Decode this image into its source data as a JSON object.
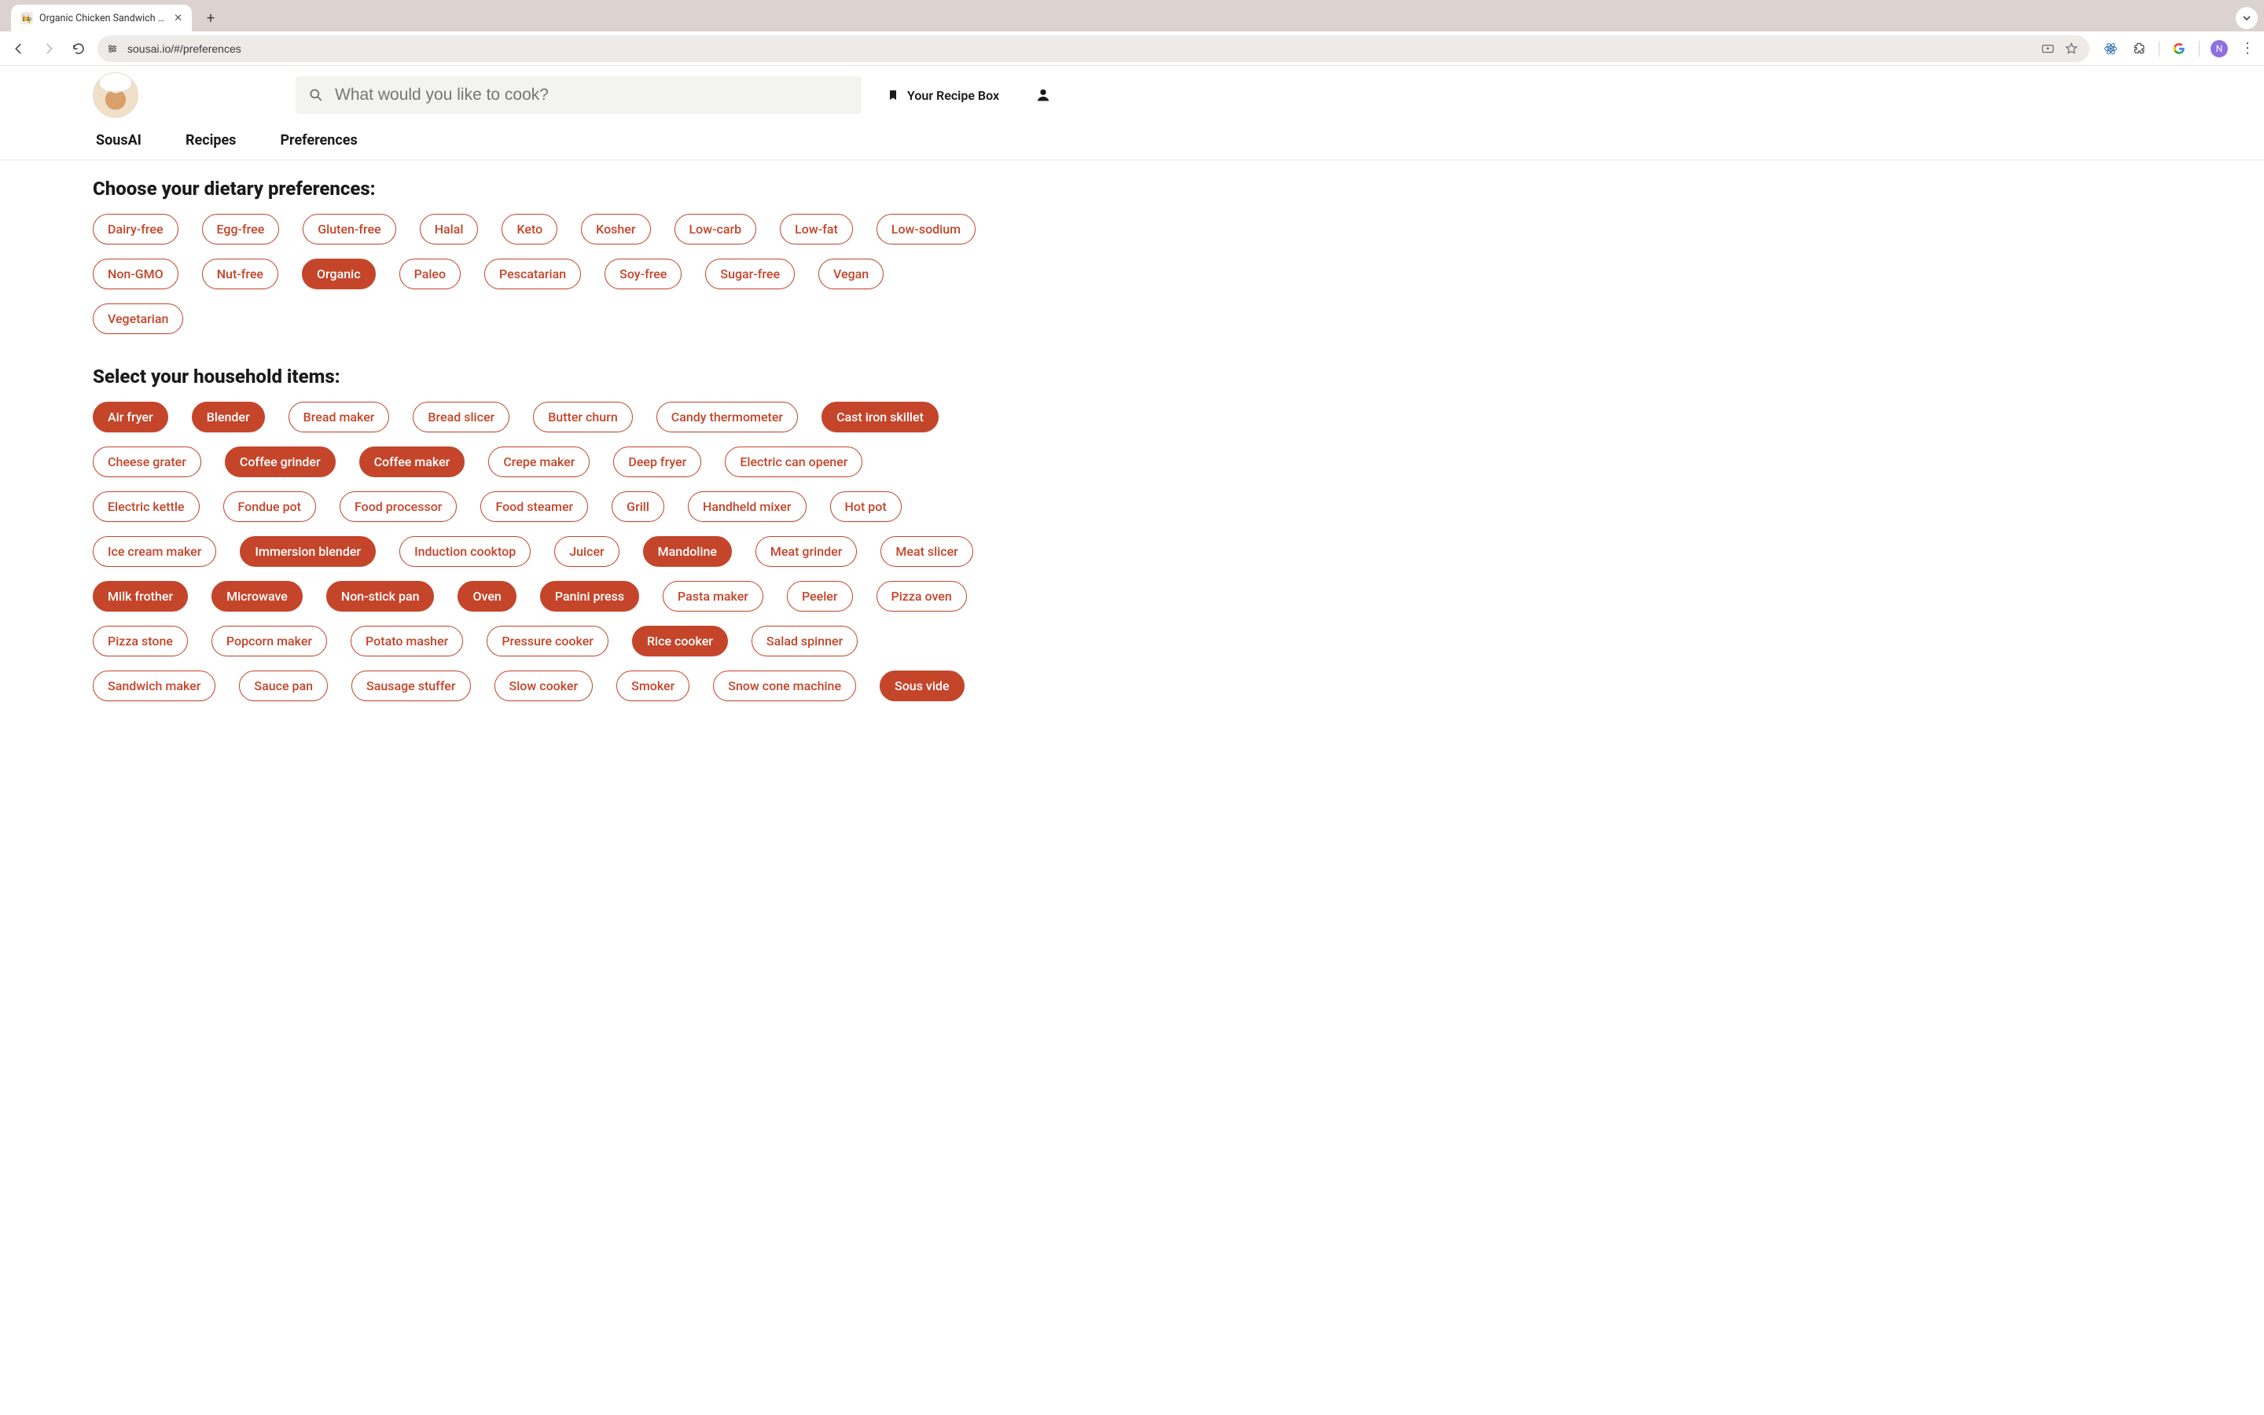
{
  "browser": {
    "tab_title": "Organic Chicken Sandwich Re",
    "url": "sousai.io/#/preferences",
    "avatar_initial": "N"
  },
  "header": {
    "search_placeholder": "What would you like to cook?",
    "recipe_box_label": "Your Recipe Box"
  },
  "nav": {
    "items": [
      "SousAI",
      "Recipes",
      "Preferences"
    ]
  },
  "sections": {
    "dietary": {
      "title": "Choose your dietary preferences:",
      "chips": [
        {
          "label": "Dairy-free",
          "selected": false
        },
        {
          "label": "Egg-free",
          "selected": false
        },
        {
          "label": "Gluten-free",
          "selected": false
        },
        {
          "label": "Halal",
          "selected": false
        },
        {
          "label": "Keto",
          "selected": false
        },
        {
          "label": "Kosher",
          "selected": false
        },
        {
          "label": "Low-carb",
          "selected": false
        },
        {
          "label": "Low-fat",
          "selected": false
        },
        {
          "label": "Low-sodium",
          "selected": false
        },
        {
          "label": "Non-GMO",
          "selected": false
        },
        {
          "label": "Nut-free",
          "selected": false
        },
        {
          "label": "Organic",
          "selected": true
        },
        {
          "label": "Paleo",
          "selected": false
        },
        {
          "label": "Pescatarian",
          "selected": false
        },
        {
          "label": "Soy-free",
          "selected": false
        },
        {
          "label": "Sugar-free",
          "selected": false
        },
        {
          "label": "Vegan",
          "selected": false
        },
        {
          "label": "Vegetarian",
          "selected": false
        }
      ]
    },
    "household": {
      "title": "Select your household items:",
      "chips": [
        {
          "label": "Air fryer",
          "selected": true
        },
        {
          "label": "Blender",
          "selected": true
        },
        {
          "label": "Bread maker",
          "selected": false
        },
        {
          "label": "Bread slicer",
          "selected": false
        },
        {
          "label": "Butter churn",
          "selected": false
        },
        {
          "label": "Candy thermometer",
          "selected": false
        },
        {
          "label": "Cast iron skillet",
          "selected": true
        },
        {
          "label": "Cheese grater",
          "selected": false
        },
        {
          "label": "Coffee grinder",
          "selected": true
        },
        {
          "label": "Coffee maker",
          "selected": true
        },
        {
          "label": "Crepe maker",
          "selected": false
        },
        {
          "label": "Deep fryer",
          "selected": false
        },
        {
          "label": "Electric can opener",
          "selected": false
        },
        {
          "label": "Electric kettle",
          "selected": false
        },
        {
          "label": "Fondue pot",
          "selected": false
        },
        {
          "label": "Food processor",
          "selected": false
        },
        {
          "label": "Food steamer",
          "selected": false
        },
        {
          "label": "Grill",
          "selected": false
        },
        {
          "label": "Handheld mixer",
          "selected": false
        },
        {
          "label": "Hot pot",
          "selected": false
        },
        {
          "label": "Ice cream maker",
          "selected": false
        },
        {
          "label": "Immersion blender",
          "selected": true
        },
        {
          "label": "Induction cooktop",
          "selected": false
        },
        {
          "label": "Juicer",
          "selected": false
        },
        {
          "label": "Mandoline",
          "selected": true
        },
        {
          "label": "Meat grinder",
          "selected": false
        },
        {
          "label": "Meat slicer",
          "selected": false
        },
        {
          "label": "Milk frother",
          "selected": true
        },
        {
          "label": "Microwave",
          "selected": true
        },
        {
          "label": "Non-stick pan",
          "selected": true
        },
        {
          "label": "Oven",
          "selected": true
        },
        {
          "label": "Panini press",
          "selected": true
        },
        {
          "label": "Pasta maker",
          "selected": false
        },
        {
          "label": "Peeler",
          "selected": false
        },
        {
          "label": "Pizza oven",
          "selected": false
        },
        {
          "label": "Pizza stone",
          "selected": false
        },
        {
          "label": "Popcorn maker",
          "selected": false
        },
        {
          "label": "Potato masher",
          "selected": false
        },
        {
          "label": "Pressure cooker",
          "selected": false
        },
        {
          "label": "Rice cooker",
          "selected": true
        },
        {
          "label": "Salad spinner",
          "selected": false
        },
        {
          "label": "Sandwich maker",
          "selected": false
        },
        {
          "label": "Sauce pan",
          "selected": false
        },
        {
          "label": "Sausage stuffer",
          "selected": false
        },
        {
          "label": "Slow cooker",
          "selected": false
        },
        {
          "label": "Smoker",
          "selected": false
        },
        {
          "label": "Snow cone machine",
          "selected": false
        },
        {
          "label": "Sous vide",
          "selected": true
        }
      ]
    }
  }
}
